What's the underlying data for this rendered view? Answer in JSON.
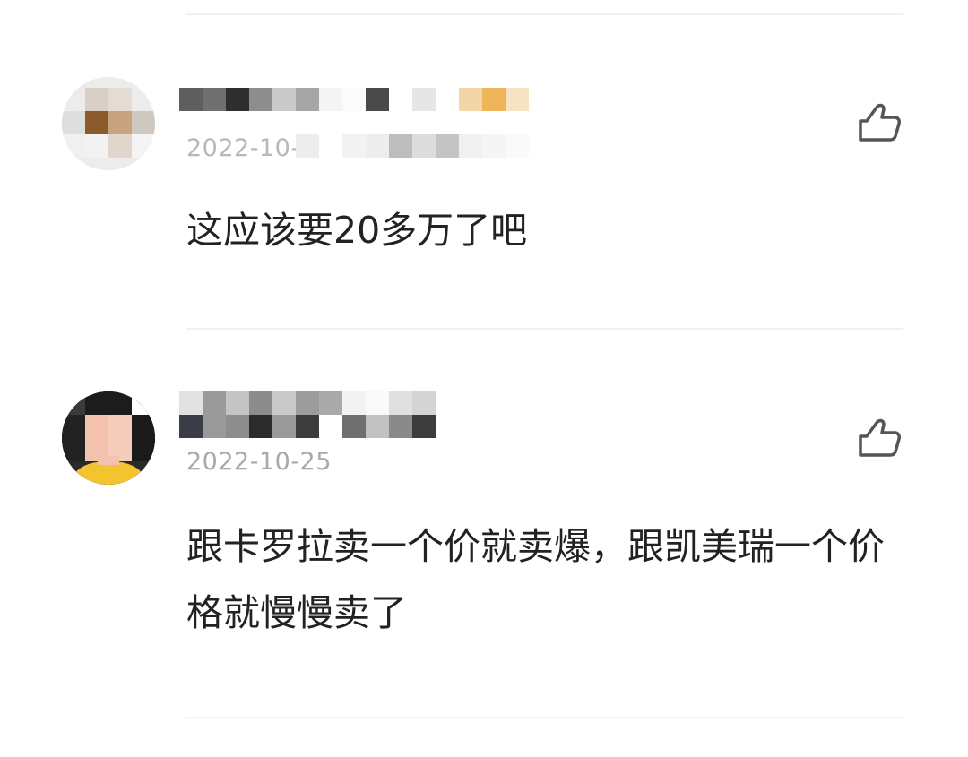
{
  "comments": [
    {
      "date": "2022-10-2",
      "text": "这应该要20多万了吧",
      "like_icon": "thumbs-up-outline-icon",
      "avatar_icon": "pixelated-avatar"
    },
    {
      "date": "2022-10-25",
      "text": "跟卡罗拉卖一个价就卖爆，跟凯美瑞一个价格就慢慢卖了",
      "like_icon": "thumbs-up-outline-icon",
      "avatar_icon": "person-avatar-yellow-shirt"
    }
  ],
  "colors": {
    "divider": "#f1f1f1",
    "date": "#a9a9a9",
    "text": "#222222",
    "icon": "#555555",
    "avatar_shirt": "#f4c430"
  }
}
